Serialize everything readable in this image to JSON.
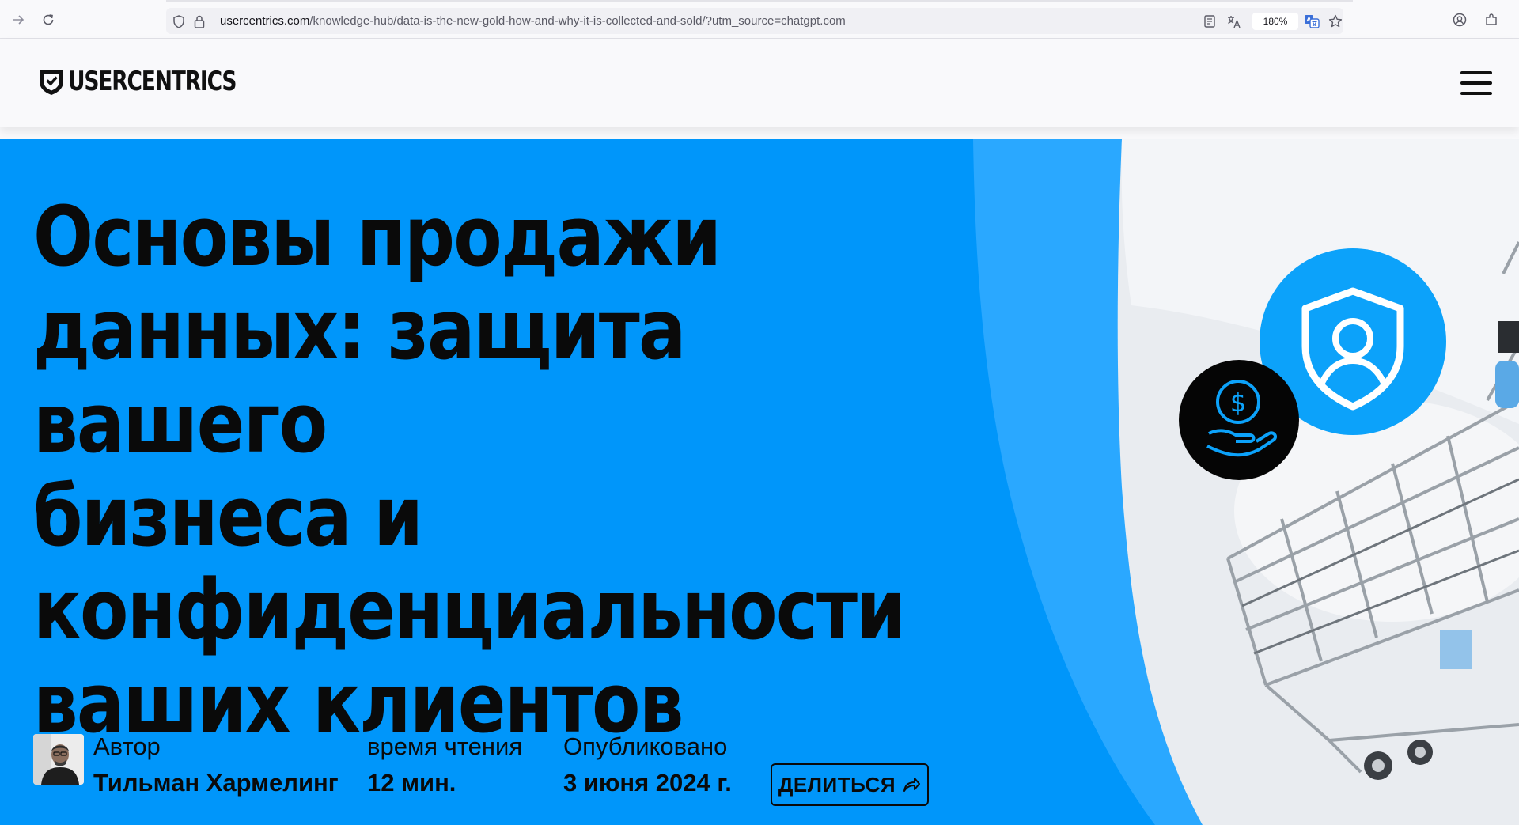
{
  "browser": {
    "url_domain": "usercentrics.com",
    "url_path": "/knowledge-hub/data-is-the-new-gold-how-and-why-it-is-collected-and-sold/?utm_source=chatgpt.com",
    "zoom": "180%"
  },
  "site": {
    "logo_text": "USERCENTRICS"
  },
  "hero": {
    "title_lines": [
      "Основы продажи",
      "данных: защита вашего",
      "бизнеса и",
      "конфиденциальности",
      "ваших клиентов"
    ],
    "author_label": "Автор",
    "author_name": "Тильман Хармелинг",
    "reading_label": "время чтения",
    "reading_value": "12 мин.",
    "published_label": "Опубликовано",
    "published_value": "3 июня 2024 г.",
    "share_label": "ДЕЛИТЬСЯ"
  },
  "colors": {
    "hero_blue": "#0096fa",
    "hero_light_blue": "#2aa8ff",
    "badge_blue": "#0ca2fa",
    "text_dark": "#0a0a0a"
  },
  "icons": [
    "back-arrow-icon",
    "reload-icon",
    "shield-tracking-icon",
    "lock-icon",
    "reader-view-icon",
    "translate-icon",
    "translate-page-icon",
    "bookmark-star-icon",
    "account-icon",
    "extensions-icon",
    "usercentrics-shield-logo-icon",
    "hamburger-menu-icon",
    "user-shield-icon",
    "money-hand-icon",
    "share-arrow-icon"
  ]
}
